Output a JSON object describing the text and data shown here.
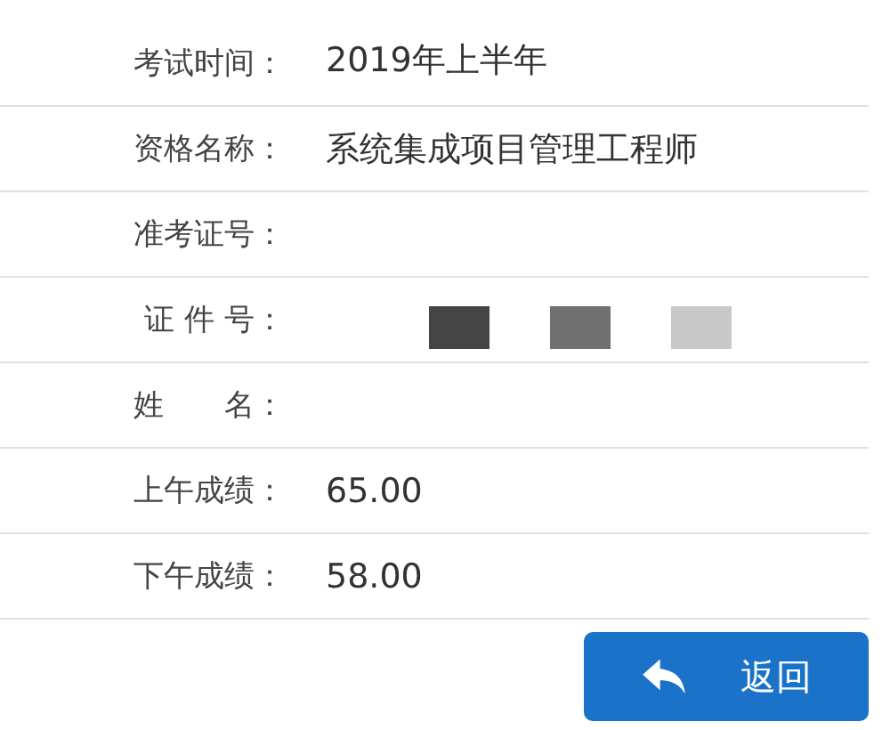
{
  "rows": [
    {
      "label": "考试时间：",
      "value": "2019年上半年"
    },
    {
      "label": "资格名称：",
      "value": "系统集成项目管理工程师"
    },
    {
      "label": "准考证号："
    },
    {
      "label": "证 件 号：",
      "redacted": true
    },
    {
      "label": "姓　　名："
    },
    {
      "label": "上午成绩：",
      "value": "65.00"
    },
    {
      "label": "下午成绩：",
      "value": "58.00"
    }
  ],
  "back_button": {
    "label": "返回"
  }
}
